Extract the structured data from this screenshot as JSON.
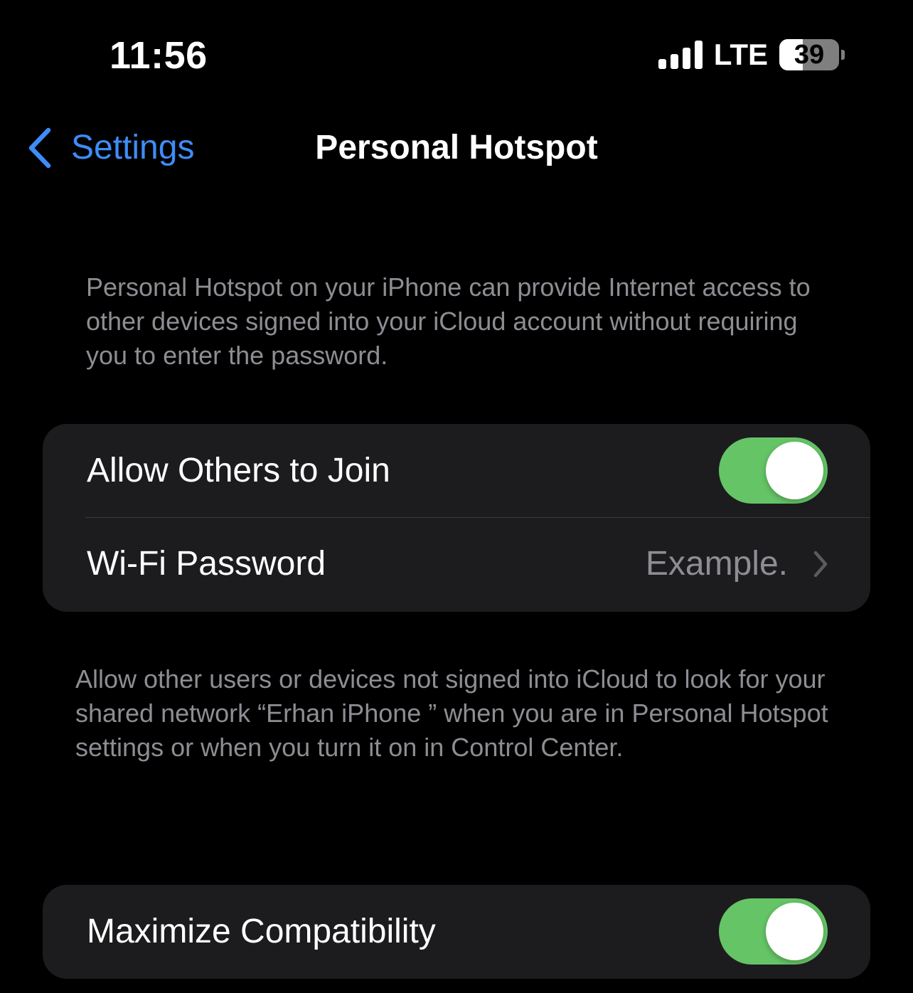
{
  "status_bar": {
    "time": "11:56",
    "network_type": "LTE",
    "signal_bars": 4,
    "battery_percent": 39,
    "battery_label": "39"
  },
  "nav": {
    "back_label": "Settings",
    "back_icon": "chevron-left-icon",
    "title": "Personal Hotspot"
  },
  "intro_text": "Personal Hotspot on your iPhone can provide Internet access to other devices signed into your iCloud account without requiring you to enter the password.",
  "group_1": {
    "allow_others": {
      "label": "Allow Others to Join",
      "enabled": true
    },
    "wifi_password": {
      "label": "Wi-Fi Password",
      "value": "Example.",
      "icon": "chevron-right-icon"
    }
  },
  "group_1_footer": "Allow other users or devices not signed into iCloud to look for your shared network “Erhan iPhone ” when you are in Personal Hotspot settings or when you turn it on in Control Center.",
  "group_2": {
    "maximize_compatibility": {
      "label": "Maximize Compatibility",
      "enabled": true
    }
  },
  "colors": {
    "background": "#000000",
    "card": "#1c1c1e",
    "accent_blue": "#3e8cf7",
    "toggle_on": "#65c466",
    "secondary_text": "#8d8d93",
    "separator": "#38383a"
  }
}
